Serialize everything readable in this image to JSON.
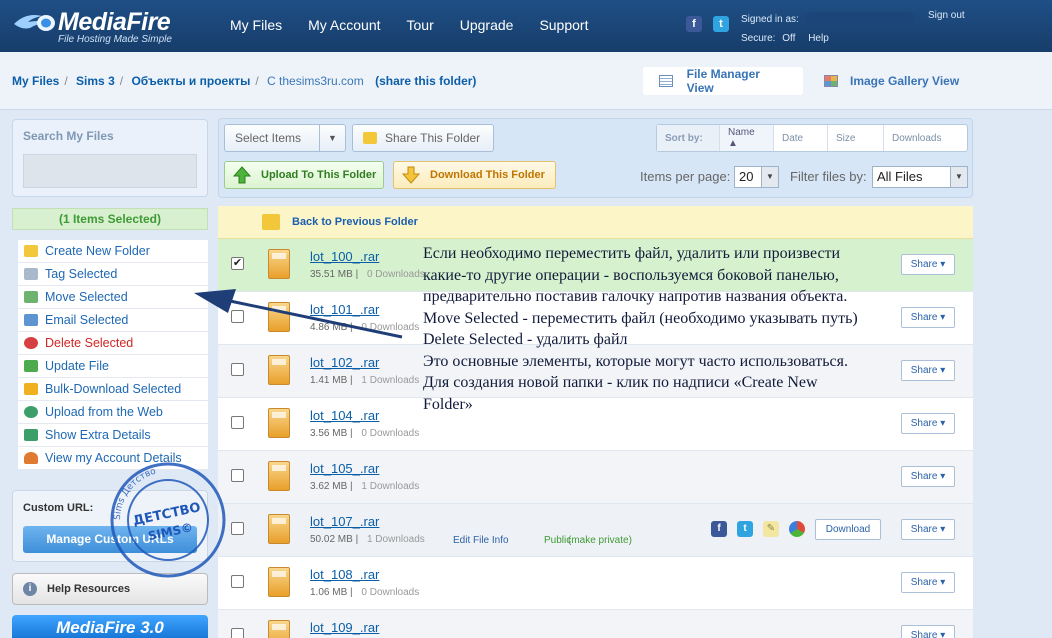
{
  "header": {
    "logo": {
      "name": "MediaFire",
      "tagline": "File Hosting Made Simple"
    },
    "nav": [
      "My Files",
      "My Account",
      "Tour",
      "Upgrade",
      "Support"
    ],
    "account": {
      "signed_in_label": "Signed in as:",
      "secure_label": "Secure:",
      "secure_value": "Off",
      "help": "Help",
      "sign_out": "Sign out"
    }
  },
  "breadcrumb": {
    "items": [
      "My Files",
      "Sims 3",
      "Объекты и проекты",
      "C thesims3ru.com"
    ],
    "share_link": "(share this folder)"
  },
  "views": {
    "file_manager": "File Manager View",
    "image_gallery": "Image Gallery View"
  },
  "sidebar": {
    "search_label": "Search My Files",
    "selected_status": "(1 Items Selected)",
    "actions": [
      {
        "label": "Create New Folder",
        "icon": "folder-icon",
        "color": "#f2c73a"
      },
      {
        "label": "Tag Selected",
        "icon": "tag-icon",
        "color": "#a9b9cc"
      },
      {
        "label": "Move Selected",
        "icon": "move-icon",
        "color": "#6db36d"
      },
      {
        "label": "Email Selected",
        "icon": "email-icon",
        "color": "#5d95d2"
      },
      {
        "label": "Delete Selected",
        "icon": "delete-icon",
        "color": "#d64040"
      },
      {
        "label": "Update File",
        "icon": "update-icon",
        "color": "#4daa4d"
      },
      {
        "label": "Bulk-Download Selected",
        "icon": "lightning-icon",
        "color": "#f0b020"
      },
      {
        "label": "Upload from the Web",
        "icon": "globe-icon",
        "color": "#3c9f6a"
      },
      {
        "label": "Show Extra Details",
        "icon": "details-icon",
        "color": "#3c9f6a"
      },
      {
        "label": "View my Account Details",
        "icon": "user-icon",
        "color": "#e07a30"
      }
    ],
    "custom_url_label": "Custom URL:",
    "custom_url_button": "Manage Custom URLs",
    "help_resources": "Help Resources",
    "promo": "MediaFire 3.0"
  },
  "toolbar": {
    "select_items": "Select Items",
    "share_folder": "Share This Folder",
    "sort_by": "Sort by:",
    "sort_options": [
      "Name ▲",
      "Date",
      "Size",
      "Downloads"
    ],
    "upload": "Upload To This Folder",
    "download": "Download This Folder",
    "items_per_page_label": "Items per page:",
    "items_per_page_value": "20",
    "filter_label": "Filter files by:",
    "filter_value": "All Files"
  },
  "back_folder": "Back to Previous Folder",
  "files": [
    {
      "name": "lot_100_.rar",
      "size": "35.51 MB",
      "downloads": "0 Downloads",
      "checked": true
    },
    {
      "name": "lot_101_.rar",
      "size": "4.86 MB",
      "downloads": "0 Downloads",
      "checked": false
    },
    {
      "name": "lot_102_.rar",
      "size": "1.41 MB",
      "downloads": "1 Downloads",
      "checked": false
    },
    {
      "name": "lot_104_.rar",
      "size": "3.56 MB",
      "downloads": "0 Downloads",
      "checked": false
    },
    {
      "name": "lot_105_.rar",
      "size": "3.62 MB",
      "downloads": "1 Downloads",
      "checked": false
    },
    {
      "name": "lot_107_.rar",
      "size": "50.02 MB",
      "downloads": "1 Downloads",
      "checked": false,
      "extra": {
        "edit": "Edit File Info",
        "public": "Public",
        "make_private": "(make private)",
        "download": "Download"
      }
    },
    {
      "name": "lot_108_.rar",
      "size": "1.06 MB",
      "downloads": "0 Downloads",
      "checked": false
    },
    {
      "name": "lot_109_.rar",
      "size": "",
      "downloads": "",
      "checked": false
    }
  ],
  "share_label": "Share ▾",
  "annotation": {
    "lines": [
      "Если необходимо переместить файл, удалить или произвести",
      "какие-то другие операции - воспользуемся боковой панелью,",
      "предварительно поставив галочку напротив названия объекта.",
      "Move Selected - переместить файл (необходимо указывать путь)",
      "Delete Selected - удалить файл",
      "Это основные элементы, которые могут часто использоваться.",
      "Для создания новой папки  - клик по надписи «Create New",
      "Folder»"
    ]
  },
  "stamp": {
    "line1": "ДЕТСТВО",
    "line2": "SIMS©",
    "ring_text": "Sims Детство"
  },
  "colors": {
    "header": "#1f4f86",
    "link": "#0b5ea8",
    "selected_row": "#d6f1cd",
    "back_bar": "#fcf5c8"
  }
}
